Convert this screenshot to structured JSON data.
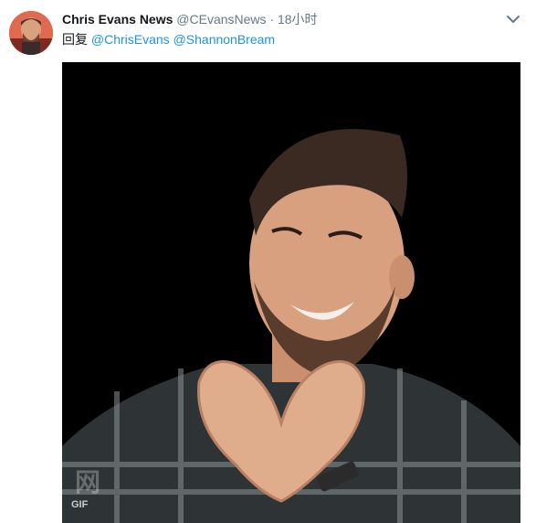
{
  "tweet": {
    "name": "Chris Evans News",
    "handle": "@CEvansNews",
    "separator": "·",
    "time": "18小时",
    "reply_prefix": "回复",
    "mentions": [
      "@ChrisEvans",
      "@ShannonBream"
    ]
  },
  "media": {
    "badge": "GIF",
    "watermark": "网"
  },
  "icons": {
    "menu": "chevron-down-icon"
  },
  "colors": {
    "name": "#14171a",
    "secondary": "#657786",
    "link": "#1b95e0"
  }
}
